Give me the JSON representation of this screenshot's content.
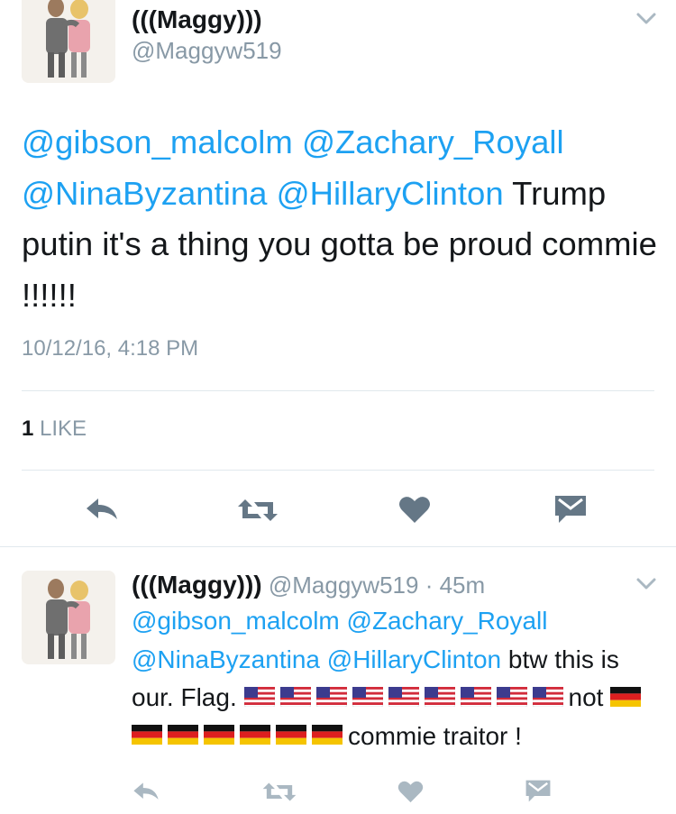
{
  "tweet": {
    "author_name": "(((Maggy)))",
    "author_handle": "@Maggyw519",
    "mentions": [
      "@gibson_malcolm",
      "@Zachary_Royall",
      "@NinaByzantina",
      "@HillaryClinton"
    ],
    "text_after_mentions": "Trump putin it's a thing you gotta be proud commie !!!!!!",
    "timestamp": "10/12/16, 4:18 PM",
    "like_count": "1",
    "like_label": "LIKE"
  },
  "reply": {
    "author_name": "(((Maggy)))",
    "author_handle": "@Maggyw519",
    "separator": "·",
    "time_ago": "45m",
    "mentions": [
      "@gibson_malcolm",
      "@Zachary_Royall",
      "@NinaByzantina",
      "@HillaryClinton"
    ],
    "text_part1": "btw this is our. Flag.",
    "us_flag_count": 9,
    "text_part2": "not",
    "de_flag_count": 7,
    "text_part3": "commie traitor !"
  },
  "colors": {
    "link": "#1da1f2",
    "muted": "#8899a6",
    "icon": "#657786",
    "divider": "#e1e8ed"
  },
  "icons": [
    "chevron-down-icon",
    "reply-icon",
    "retweet-icon",
    "heart-icon",
    "envelope-icon"
  ]
}
